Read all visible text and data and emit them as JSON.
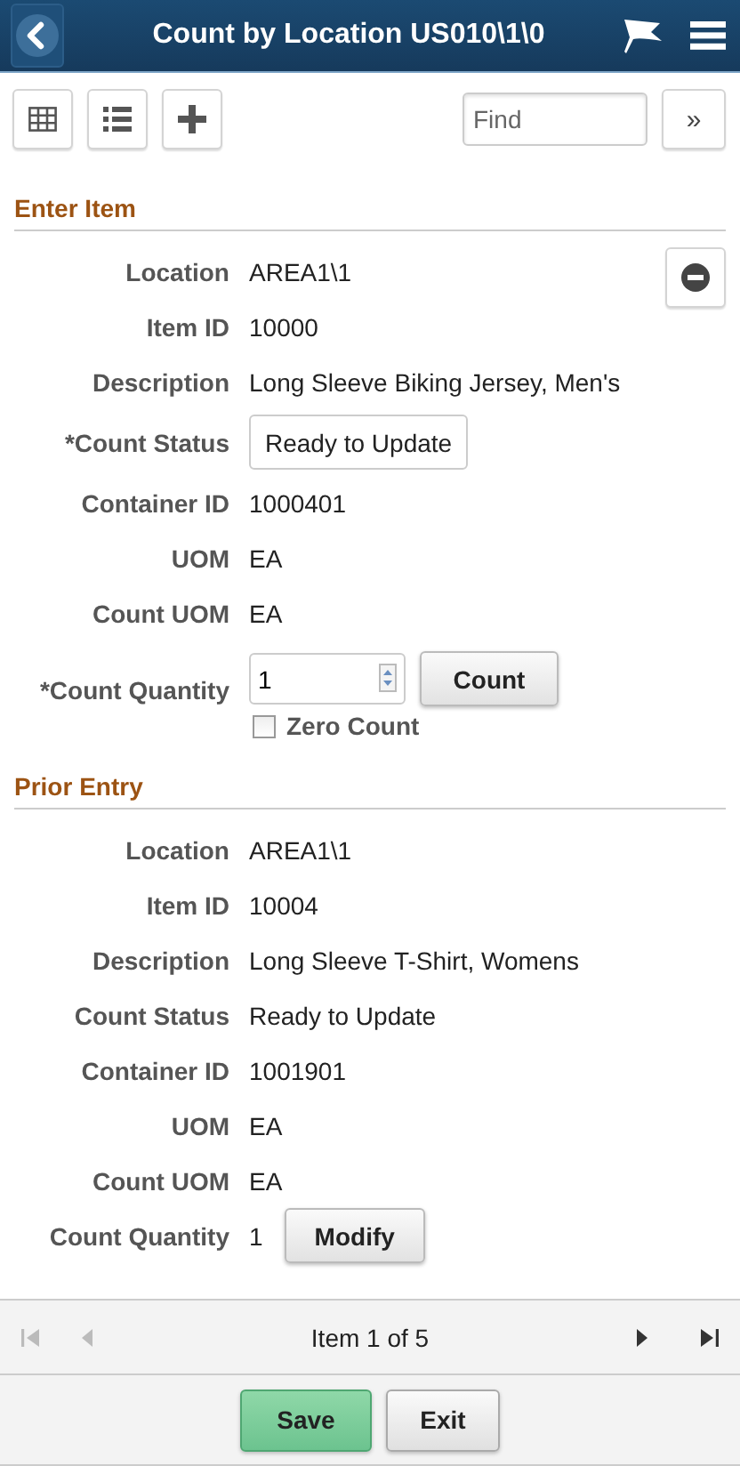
{
  "header": {
    "title": "Count by Location US010\\1\\0"
  },
  "toolbar": {
    "find": {
      "placeholder": "Find"
    },
    "more": "»"
  },
  "sections": [
    {
      "title": "Enter Item",
      "removable": true,
      "fields": [
        {
          "kind": "text",
          "label": "Location",
          "value": "AREA1\\1"
        },
        {
          "kind": "text",
          "label": "Item ID",
          "value": "10000"
        },
        {
          "kind": "text",
          "label": "Description",
          "value": "Long Sleeve Biking Jersey, Men's"
        },
        {
          "kind": "select",
          "label": "*Count Status",
          "value": "Ready to Update"
        },
        {
          "kind": "text",
          "label": "Container ID",
          "value": "1000401"
        },
        {
          "kind": "text",
          "label": "UOM",
          "value": "EA"
        },
        {
          "kind": "text",
          "label": "Count UOM",
          "value": "EA"
        },
        {
          "kind": "quantity",
          "label": "*Count Quantity",
          "value": "1",
          "button": "Count",
          "checkbox": {
            "label": "Zero Count",
            "checked": false
          }
        }
      ]
    },
    {
      "title": "Prior Entry",
      "removable": false,
      "fields": [
        {
          "kind": "text",
          "label": "Location",
          "value": "AREA1\\1"
        },
        {
          "kind": "text",
          "label": "Item ID",
          "value": "10004"
        },
        {
          "kind": "text",
          "label": "Description",
          "value": "Long Sleeve T-Shirt, Womens"
        },
        {
          "kind": "text",
          "label": "Count Status",
          "value": "Ready to Update"
        },
        {
          "kind": "text",
          "label": "Container ID",
          "value": "1001901"
        },
        {
          "kind": "text",
          "label": "UOM",
          "value": "EA"
        },
        {
          "kind": "text",
          "label": "Count UOM",
          "value": "EA"
        },
        {
          "kind": "text_button",
          "label": "Count Quantity",
          "value": "1",
          "button": "Modify"
        }
      ]
    }
  ],
  "pager": {
    "status": "Item 1 of 5",
    "nav": [
      {
        "kind": "first",
        "disabled": true
      },
      {
        "kind": "prev",
        "disabled": true
      },
      {
        "kind": "next",
        "disabled": false
      },
      {
        "kind": "last",
        "disabled": false
      }
    ]
  },
  "footer": {
    "buttons": [
      {
        "label": "Save",
        "kind": "primary"
      },
      {
        "label": "Exit",
        "kind": "secondary"
      }
    ]
  }
}
